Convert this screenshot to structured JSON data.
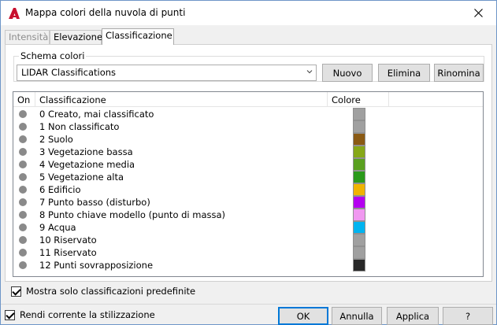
{
  "window": {
    "title": "Mappa colori della nuvola di punti",
    "close_icon": "close-icon"
  },
  "tabs": [
    {
      "label": "Intensità",
      "state": "disabled"
    },
    {
      "label": "Elevazione",
      "state": "normal"
    },
    {
      "label": "Classificazione",
      "state": "active"
    }
  ],
  "scheme": {
    "group_label": "Schema colori",
    "selected": "LIDAR Classifications",
    "buttons": {
      "new": "Nuovo",
      "delete": "Elimina",
      "rename": "Rinomina"
    }
  },
  "table": {
    "headers": {
      "on": "On",
      "classification": "Classificazione",
      "color": "Colore"
    },
    "rows": [
      {
        "label": "0 Creato, mai classificato",
        "color": "#a0a0a0"
      },
      {
        "label": "1 Non classificato",
        "color": "#a0a0a0"
      },
      {
        "label": "2 Suolo",
        "color": "#8a5a14"
      },
      {
        "label": "3 Vegetazione bassa",
        "color": "#86a818"
      },
      {
        "label": "4 Vegetazione media",
        "color": "#5aa020"
      },
      {
        "label": "5 Vegetazione alta",
        "color": "#2a9a1a"
      },
      {
        "label": "6 Edificio",
        "color": "#f0b400"
      },
      {
        "label": "7 Punto basso (disturbo)",
        "color": "#b400f0"
      },
      {
        "label": "8 Punto chiave modello (punto di massa)",
        "color": "#f098f0"
      },
      {
        "label": "9 Acqua",
        "color": "#00b4f0"
      },
      {
        "label": "10 Riservato",
        "color": "#a0a0a0"
      },
      {
        "label": "11 Riservato",
        "color": "#a0a0a0"
      },
      {
        "label": "12 Punti sovrapposizione",
        "color": "#282828"
      }
    ]
  },
  "options": {
    "predefined_only": {
      "label": "Mostra solo classificazioni predefinite",
      "checked": true
    }
  },
  "footer": {
    "current_style": {
      "label": "Rendi corrente la stilizzazione",
      "checked": true
    },
    "buttons": {
      "ok": "OK",
      "cancel": "Annulla",
      "apply": "Applica",
      "help": "?"
    }
  }
}
